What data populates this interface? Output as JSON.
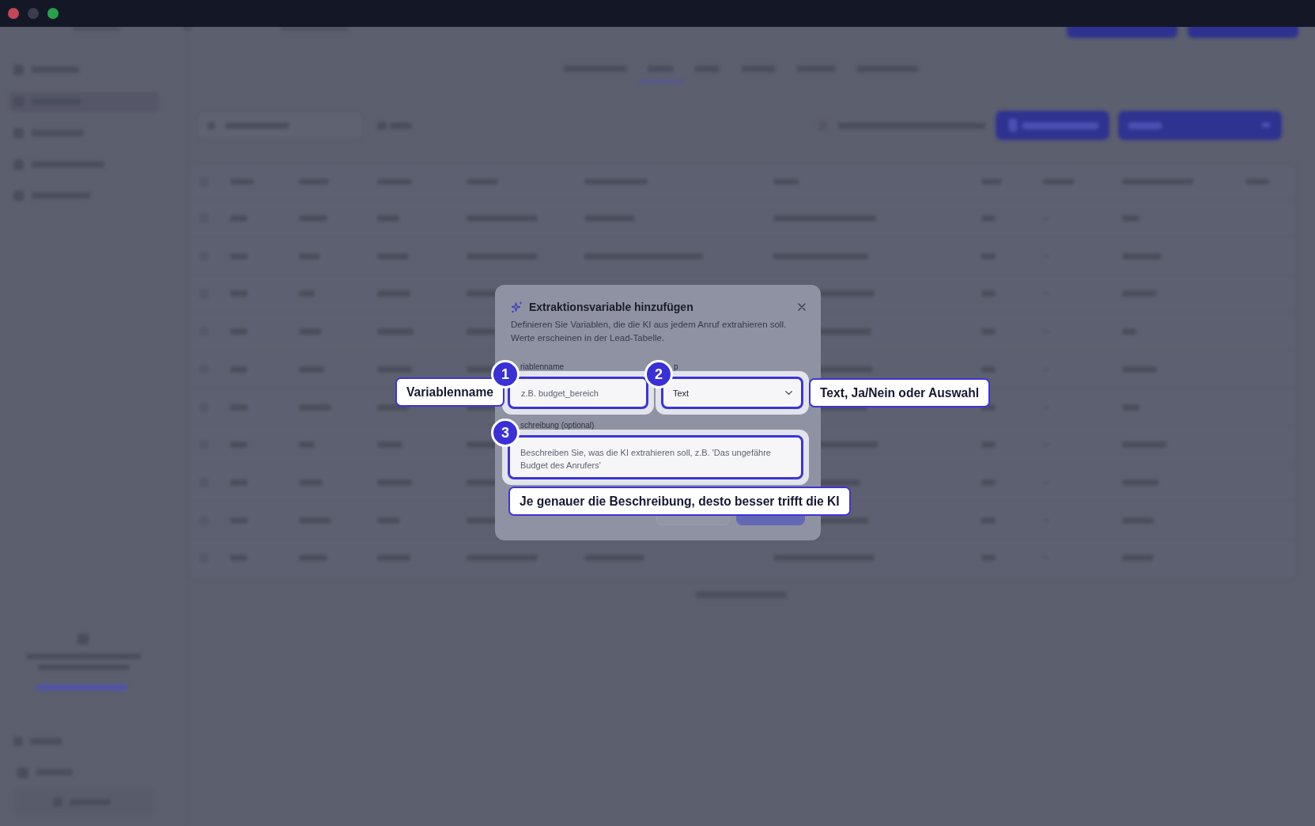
{
  "window": {
    "controls": [
      {
        "kind": "close",
        "disabled": false
      },
      {
        "kind": "minimize",
        "disabled": true
      },
      {
        "kind": "zoom",
        "disabled": false
      }
    ]
  },
  "dialog": {
    "title": "Extraktionsvariable hinzufügen",
    "description": "Definieren Sie Variablen, die die KI aus jedem Anruf extrahieren soll. Werte erscheinen in der Lead-Tabelle.",
    "fields": [
      {
        "kind": "input",
        "label": "riablenname",
        "placeholder": "z.B. budget_bereich",
        "highlighted": true,
        "tour": {
          "step": "1",
          "hint": "Variablenname"
        }
      },
      {
        "kind": "select",
        "label": "p",
        "value": "Text",
        "highlighted": true,
        "tour": {
          "step": "2",
          "hint": "Text, Ja/Nein oder Auswahl"
        }
      },
      {
        "kind": "textarea",
        "label": "schreibung (optional)",
        "placeholder": "Beschreiben Sie, was die KI extrahieren soll, z.B. 'Das ungefähre Budget des Anrufers'",
        "highlighted": true,
        "tour": {
          "step": "3",
          "hint": "Je genauer die Beschreibung, desto besser trifft die KI"
        }
      }
    ]
  }
}
